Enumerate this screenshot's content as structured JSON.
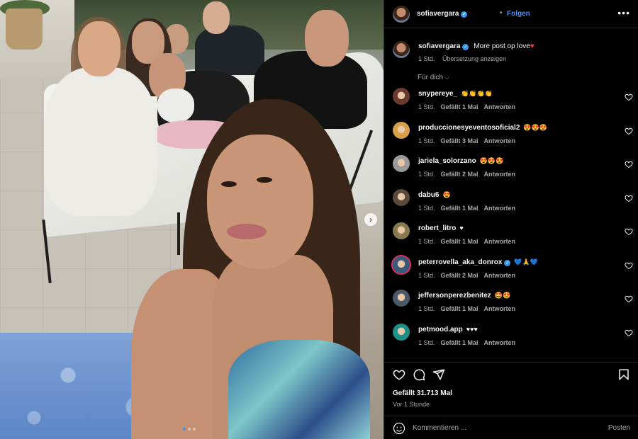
{
  "post": {
    "username": "sofiavergara",
    "separator": "•",
    "follow_label": "Folgen",
    "more_label": "•••",
    "caption_text": "More post op love",
    "caption_emoji": "♥",
    "caption_time": "1 Std.",
    "translate_label": "Übersetzung anzeigen",
    "filter_label": "Für dich",
    "next_label": "›"
  },
  "comments": [
    {
      "user": "snypereye_",
      "text": "👏👏👏👏",
      "time": "1 Std.",
      "likes": "Gefällt 1 Mal",
      "reply": "Antworten",
      "avatar_color": "#6b3a2e"
    },
    {
      "user": "produccionesyeventosoficial2",
      "text": "😍😍😍",
      "time": "1 Std.",
      "likes": "Gefällt 3 Mal",
      "reply": "Antworten",
      "avatar_color": "#d9a04a"
    },
    {
      "user": "jariela_solorzano",
      "text": "😍😍😍",
      "time": "1 Std.",
      "likes": "Gefällt 2 Mal",
      "reply": "Antworten",
      "avatar_color": "#9a9a9a"
    },
    {
      "user": "dabu6",
      "text": "😍",
      "time": "1 Std.",
      "likes": "Gefällt 1 Mal",
      "reply": "Antworten",
      "avatar_color": "#5a4a3a"
    },
    {
      "user": "robert_litro",
      "text": "♥",
      "time": "1 Std.",
      "likes": "Gefällt 1 Mal",
      "reply": "Antworten",
      "avatar_color": "#8a7a50"
    },
    {
      "user": "peterrovella_aka_donrox",
      "text": "💙🙏💙",
      "time": "1 Std.",
      "likes": "Gefällt 2 Mal",
      "reply": "Antworten",
      "avatar_color": "#3a5a7a",
      "verified": true
    },
    {
      "user": "jeffersonperezbenitez",
      "text": "🤩😍",
      "time": "1 Std.",
      "likes": "Gefällt 1 Mal",
      "reply": "Antworten",
      "avatar_color": "#4a5a6a"
    },
    {
      "user": "petmood.app",
      "text": "♥♥♥",
      "time": "1 Std.",
      "likes": "Gefällt 1 Mal",
      "reply": "Antworten",
      "avatar_color": "#1f8f8a"
    }
  ],
  "footer": {
    "likes_count": "Gefällt 31.713 Mal",
    "time_ago": "Vor 1 Stunde",
    "comment_placeholder": "Kommentieren ...",
    "post_label": "Posten"
  },
  "icons": {
    "heart": "heart-icon",
    "comment": "comment-icon",
    "share": "share-icon",
    "save": "bookmark-icon",
    "emoji": "emoji-icon"
  },
  "colors": {
    "accent": "#4a8ff8",
    "verified": "#3897f0",
    "background": "#000000",
    "secondary_text": "#a8a8a8"
  },
  "carousel": {
    "slides": 3,
    "active": 1
  }
}
